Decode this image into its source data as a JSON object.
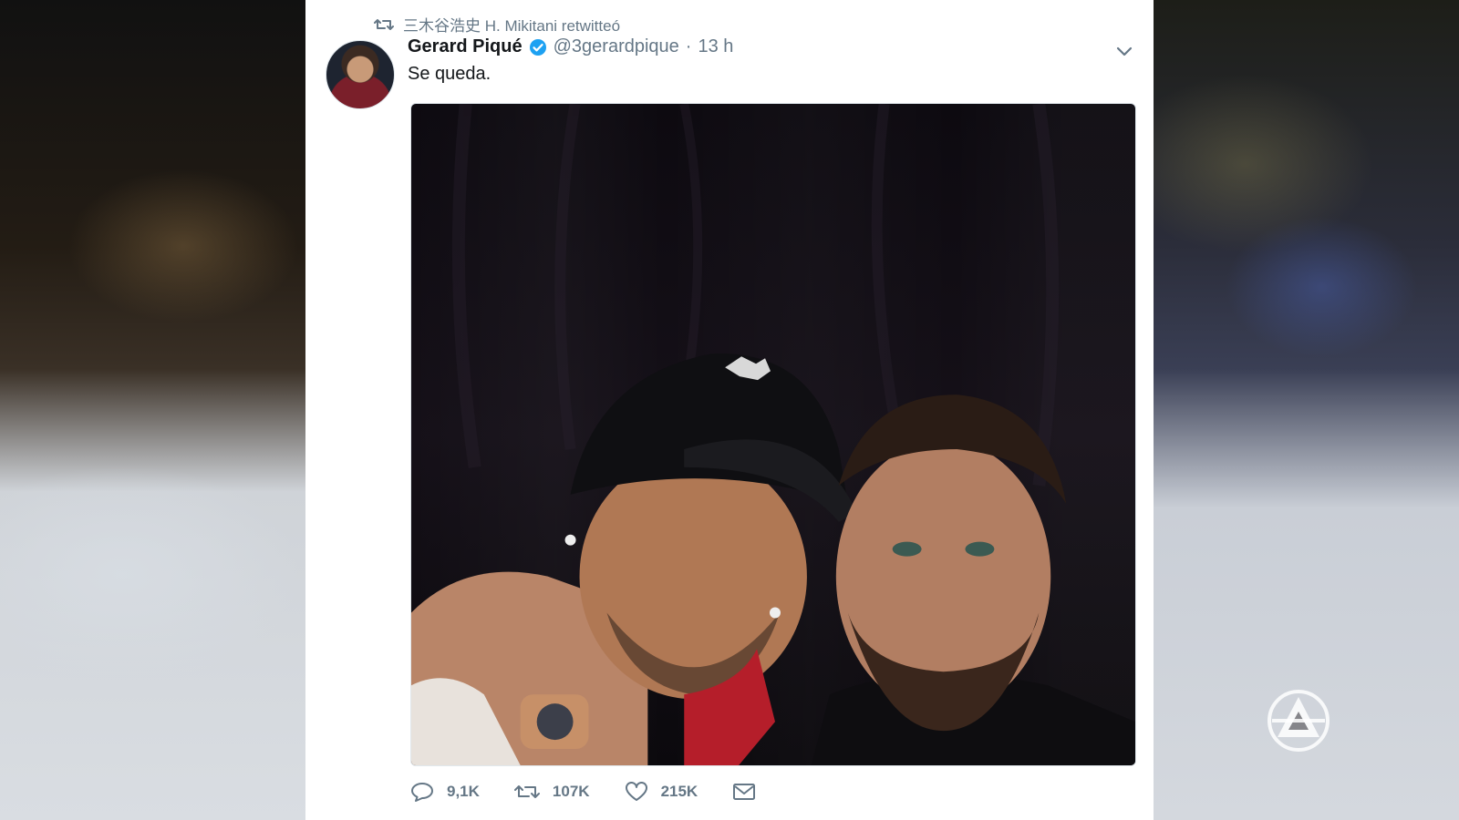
{
  "retweet": {
    "icon": "retweet-icon",
    "text": "三木谷浩史 H. Mikitani retwitteó"
  },
  "tweet": {
    "author_name": "Gerard Piqué",
    "verified": true,
    "handle": "@3gerardpique",
    "separator": "·",
    "time": "13 h",
    "text": "Se queda.",
    "media": "photo-selfie",
    "actions": {
      "reply_count": "9,1K",
      "retweet_count": "107K",
      "like_count": "215K"
    }
  },
  "colors": {
    "verified_blue": "#1da1f2",
    "text_primary": "#14171a",
    "text_secondary": "#657786"
  },
  "broadcast_logo": "antena3-logo"
}
